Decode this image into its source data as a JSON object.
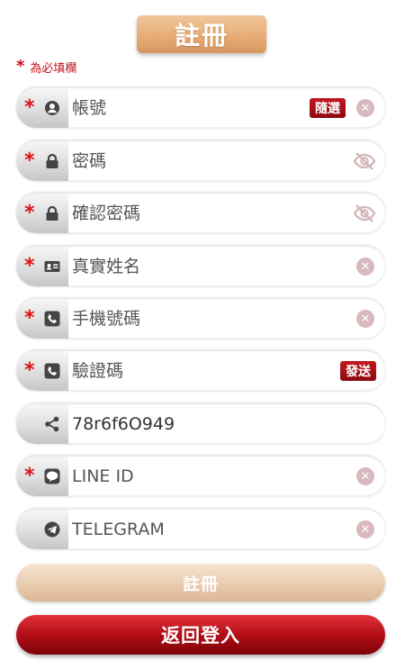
{
  "header": {
    "title": "註冊"
  },
  "required_note": {
    "star": "*",
    "text": "為必填欄"
  },
  "fields": [
    {
      "placeholder": "帳號",
      "value": "",
      "required": true,
      "icon": "user-circle-icon",
      "chip": "隨選",
      "trailing": "clear"
    },
    {
      "placeholder": "密碼",
      "value": "",
      "required": true,
      "icon": "lock-icon",
      "trailing": "eye-off"
    },
    {
      "placeholder": "確認密碼",
      "value": "",
      "required": true,
      "icon": "lock-icon",
      "trailing": "eye-off"
    },
    {
      "placeholder": "真實姓名",
      "value": "",
      "required": true,
      "icon": "id-card-icon",
      "trailing": "clear"
    },
    {
      "placeholder": "手機號碼",
      "value": "",
      "required": true,
      "icon": "phone-icon",
      "trailing": "clear"
    },
    {
      "placeholder": "驗證碼",
      "value": "",
      "required": true,
      "icon": "phone-icon",
      "chip": "發送"
    },
    {
      "placeholder": "",
      "value": "78r6f6O949",
      "required": false,
      "icon": "share-icon"
    },
    {
      "placeholder": "LINE ID",
      "value": "",
      "required": true,
      "icon": "line-icon",
      "trailing": "clear"
    },
    {
      "placeholder": "TELEGRAM",
      "value": "",
      "required": false,
      "icon": "telegram-icon",
      "trailing": "clear"
    }
  ],
  "buttons": {
    "submit": "註冊",
    "back": "返回登入"
  },
  "colors": {
    "accent_red": "#b20d16",
    "gold": "#e7ad78",
    "required_star": "#e01010"
  }
}
